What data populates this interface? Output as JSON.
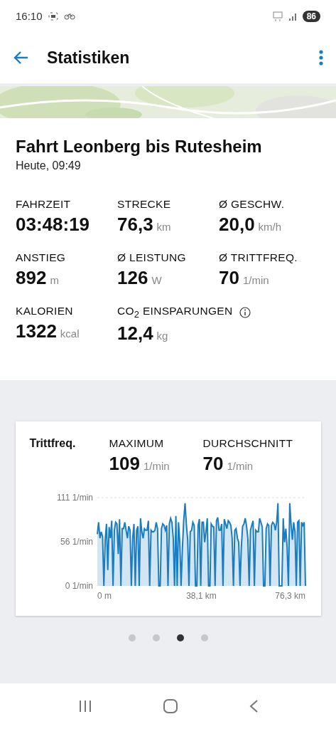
{
  "status_bar": {
    "time": "16:10",
    "battery": "86"
  },
  "app_bar": {
    "title": "Statistiken"
  },
  "ride": {
    "title": "Fahrt Leonberg bis Rutesheim",
    "date": "Heute, 09:49"
  },
  "stats": [
    {
      "label": "FAHRZEIT",
      "value": "03:48:19",
      "info": false
    },
    {
      "label": "STRECKE",
      "value": "76,3",
      "unit": "km",
      "info": false
    },
    {
      "label": "Ø GESCHW.",
      "value": "20,0",
      "unit": "km/h",
      "info": false
    },
    {
      "label": "ANSTIEG",
      "value": "892",
      "unit": "m",
      "info": false
    },
    {
      "label": "Ø LEISTUNG",
      "value": "126",
      "unit": "W",
      "info": false
    },
    {
      "label": "Ø TRITTFREQ.",
      "value": "70",
      "unit": "1/min",
      "info": false
    },
    {
      "label": "KALORIEN",
      "value": "1322",
      "unit": "kcal",
      "info": false
    },
    {
      "label": "CO$_{2}$ EINSPARUNGEN",
      "value": "12,4",
      "unit": "kg",
      "info": true
    }
  ],
  "chart_card": {
    "title": "Trittfreq.",
    "summary": [
      {
        "label": "MAXIMUM",
        "value": "109",
        "unit": "1/min"
      },
      {
        "label": "DURCHSCHNITT",
        "value": "70",
        "unit": "1/min"
      }
    ],
    "plot": {
      "y_labels": [
        "111 1/min",
        "56 1/min",
        "0 1/min"
      ],
      "x_labels": [
        "0 m",
        "38,1 km",
        "76,3 km"
      ]
    }
  },
  "pager": [
    {
      "selected": false
    },
    {
      "selected": false
    },
    {
      "selected": true
    },
    {
      "selected": false
    }
  ]
}
